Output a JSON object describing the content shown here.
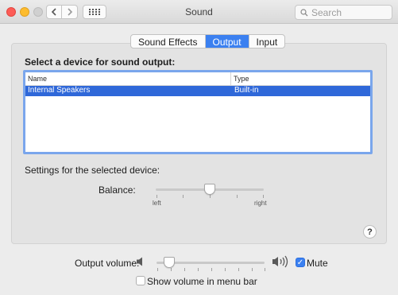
{
  "window": {
    "title": "Sound",
    "search": {
      "placeholder": "Search"
    },
    "icons": [
      "close-button",
      "minimize-button",
      "zoom-button",
      "chevron-left-icon",
      "chevron-right-icon",
      "grid-icon",
      "search-icon"
    ]
  },
  "tabs": [
    {
      "label": "Sound Effects",
      "active": false
    },
    {
      "label": "Output",
      "active": true
    },
    {
      "label": "Input",
      "active": false
    }
  ],
  "output": {
    "section_title": "Select a device for sound output:",
    "table": {
      "columns": [
        "Name",
        "Type"
      ],
      "rows": [
        {
          "name": "Internal Speakers",
          "type": "Built-in",
          "selected": true
        }
      ]
    },
    "settings_label": "Settings for the selected device:",
    "balance": {
      "label": "Balance:",
      "left_label": "left",
      "right_label": "right",
      "value_fraction": 0.5
    }
  },
  "help_label": "?",
  "volume": {
    "label": "Output volume:",
    "value_fraction": 0.12,
    "mute_label": "Mute",
    "mute_checked": true
  },
  "menubar": {
    "label": "Show volume in menu bar",
    "checked": false
  },
  "colors": {
    "accent": "#3b80f0",
    "selection": "#2f68d9",
    "close": "#fd5c57",
    "minimize": "#fdbc2e"
  }
}
